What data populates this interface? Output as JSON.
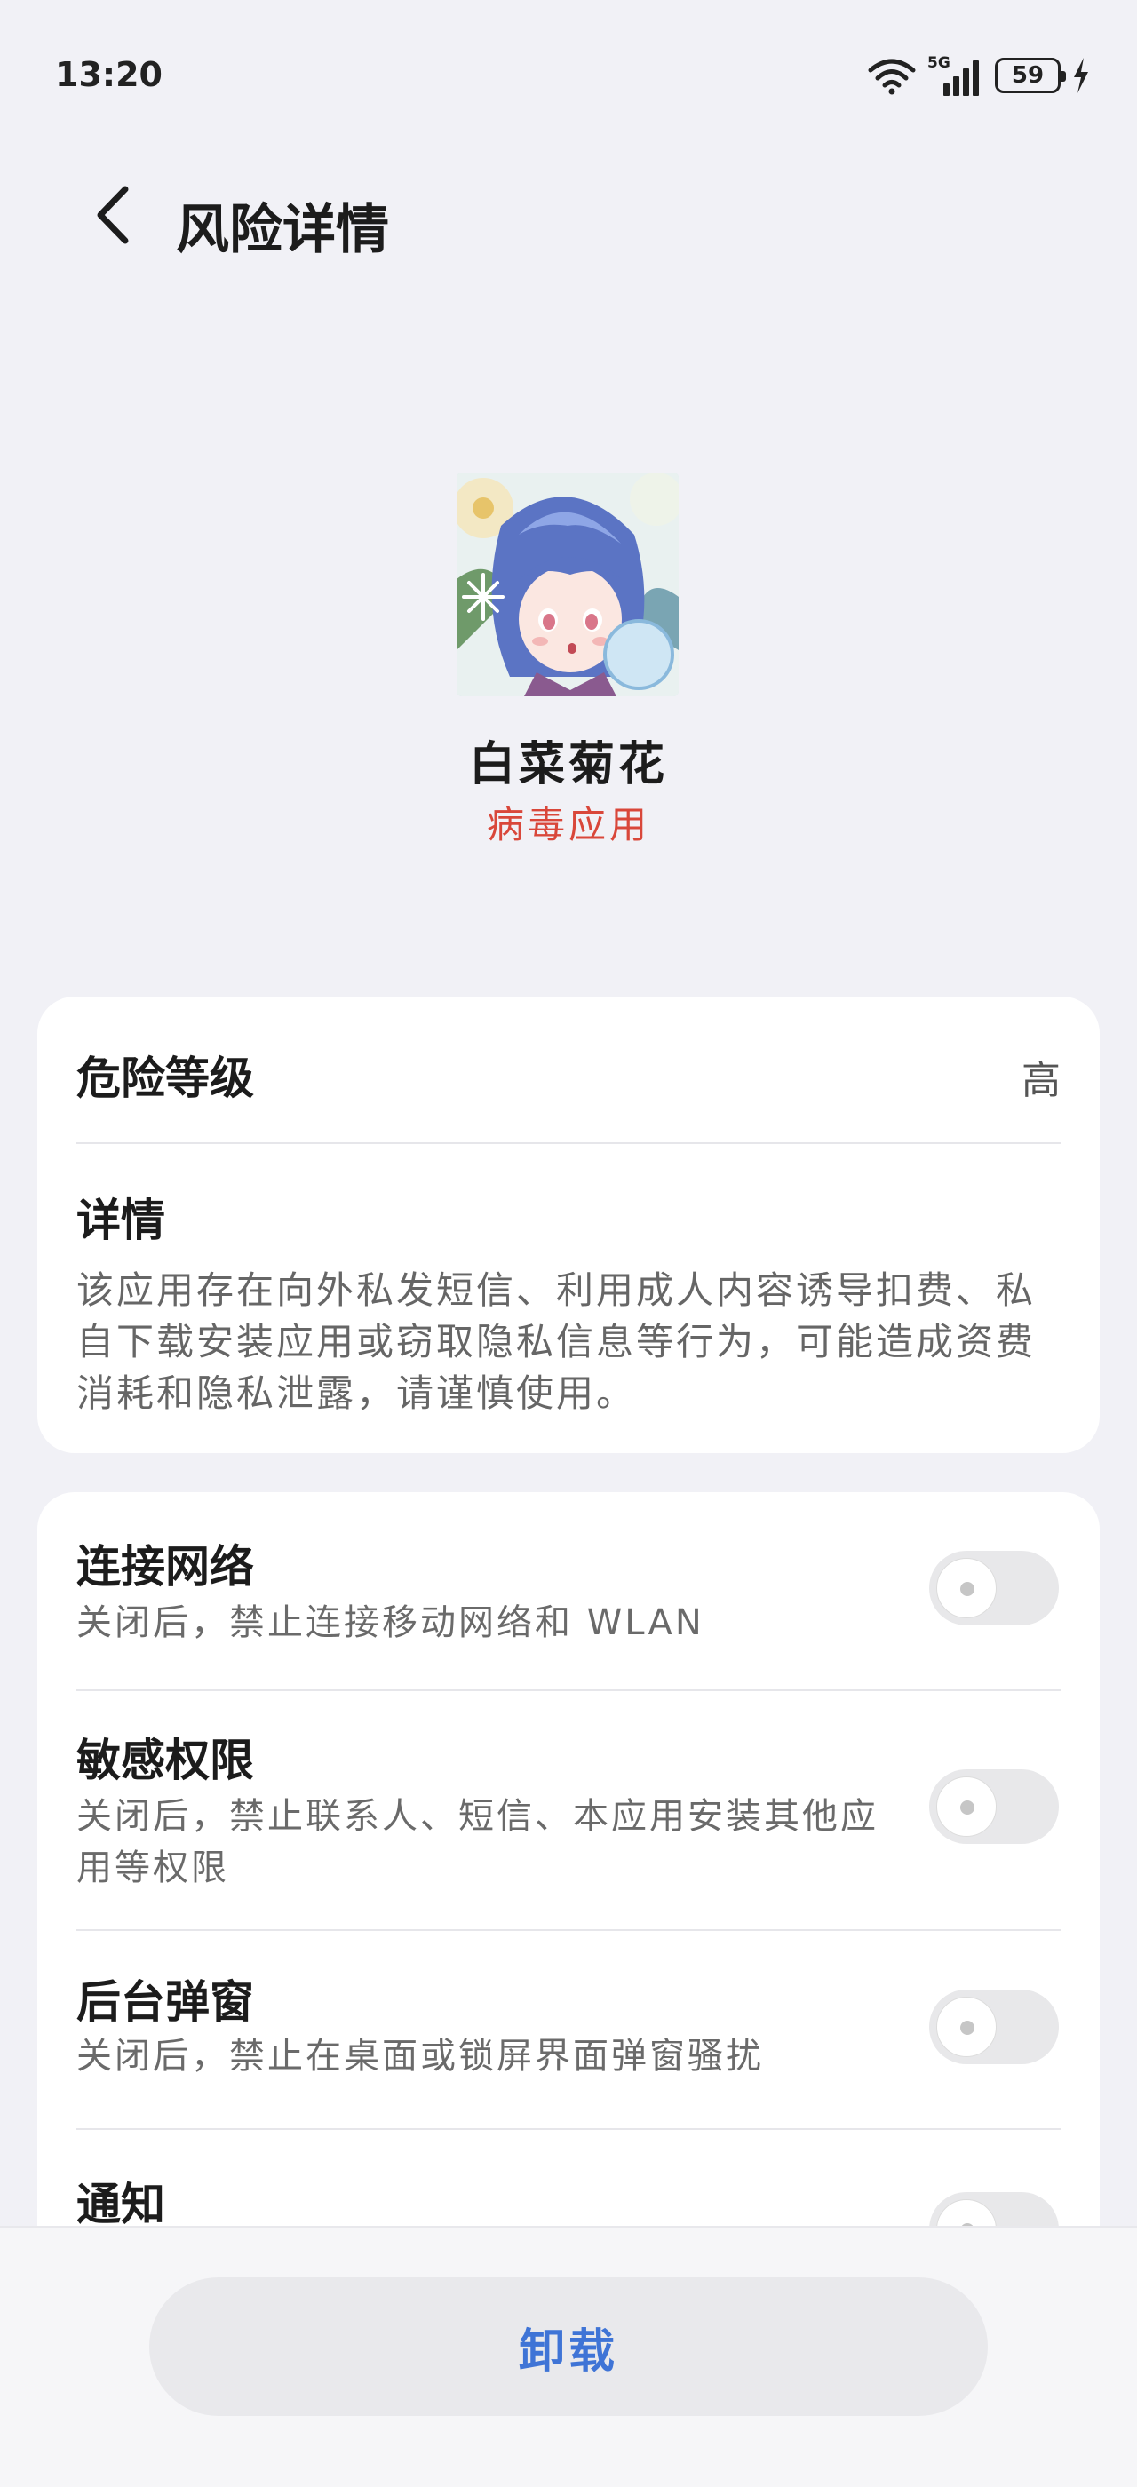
{
  "status_bar": {
    "time": "13:20",
    "network": "5G",
    "battery": "59",
    "icons": [
      "wifi-icon",
      "signal-icon",
      "battery-icon",
      "charging-icon"
    ]
  },
  "header": {
    "title": "风险详情",
    "back_icon": "chevron-left-icon"
  },
  "app": {
    "name": "白菜菊花",
    "tag": "病毒应用"
  },
  "risk": {
    "level_label": "危险等级",
    "level_value": "高",
    "detail_label": "详情",
    "detail_text": "该应用存在向外私发短信、利用成人内容诱导扣费、私自下载安装应用或窃取隐私信息等行为，可能造成资费消耗和隐私泄露，请谨慎使用。"
  },
  "permissions": [
    {
      "label": "连接网络",
      "desc": "关闭后，禁止连接移动网络和 WLAN",
      "enabled": false
    },
    {
      "label": "敏感权限",
      "desc": "关闭后，禁止联系人、短信、本应用安装其他应用等权限",
      "enabled": false
    },
    {
      "label": "后台弹窗",
      "desc": "关闭后，禁止在桌面或锁屏界面弹窗骚扰",
      "enabled": false
    },
    {
      "label": "通知",
      "desc": "",
      "enabled": false
    }
  ],
  "actions": {
    "uninstall_label": "卸载"
  },
  "colors": {
    "background": "#f1f1f6",
    "danger": "#d9473a",
    "accent": "#3f74d6"
  }
}
